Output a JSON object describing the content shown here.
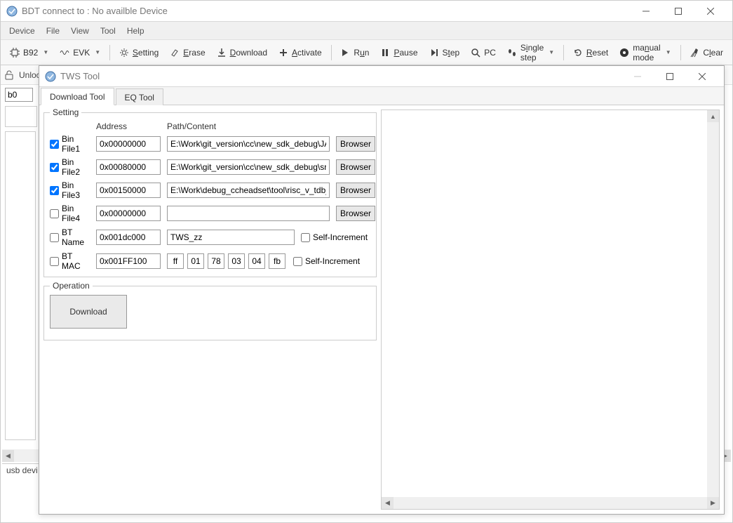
{
  "main_window": {
    "title": "BDT connect to : No availble Device",
    "menu": {
      "device": "Device",
      "file": "File",
      "view": "View",
      "tool": "Tool",
      "help": "Help"
    },
    "toolbar": {
      "chip": "B92",
      "board": "EVK",
      "setting": "Setting",
      "erase": "Erase",
      "download": "Download",
      "activate": "Activate",
      "run": "Run",
      "pause": "Pause",
      "step": "Step",
      "pc": "PC",
      "single_step": "Single step",
      "reset": "Reset",
      "manual_mode": "manual mode",
      "clear": "Clear"
    },
    "subbar": {
      "unlock": "Unlock",
      "b0": "b0"
    },
    "status": "usb devi"
  },
  "tws": {
    "title": "TWS Tool",
    "tabs": {
      "download": "Download Tool",
      "eq": "EQ Tool"
    },
    "setting_legend": "Setting",
    "headers": {
      "address": "Address",
      "path": "Path/Content"
    },
    "rows": [
      {
        "checked": true,
        "label": "Bin File1",
        "addr": "0x00000000",
        "path": "E:\\Work\\git_version\\cc\\new_sdk_debug\\JAGUA"
      },
      {
        "checked": true,
        "label": "Bin File2",
        "addr": "0x00080000",
        "path": "E:\\Work\\git_version\\cc\\new_sdk_debug\\src\\_pr"
      },
      {
        "checked": true,
        "label": "Bin File3",
        "addr": "0x00150000",
        "path": "E:\\Work\\debug_ccheadset\\tool\\risc_v_tdb_tws'"
      },
      {
        "checked": false,
        "label": "Bin File4",
        "addr": "0x00000000",
        "path": ""
      }
    ],
    "browser": "Browser",
    "btname": {
      "label": "BT Name",
      "addr": "0x001dc000",
      "value": "TWS_zz",
      "self_inc": "Self-Increment",
      "checked": false
    },
    "btmac": {
      "label": "BT MAC",
      "addr": "0x001FF100",
      "parts": [
        "ff",
        "01",
        "78",
        "03",
        "04",
        "fb"
      ],
      "self_inc": "Self-Increment",
      "checked": false
    },
    "operation_legend": "Operation",
    "download_btn": "Download"
  }
}
